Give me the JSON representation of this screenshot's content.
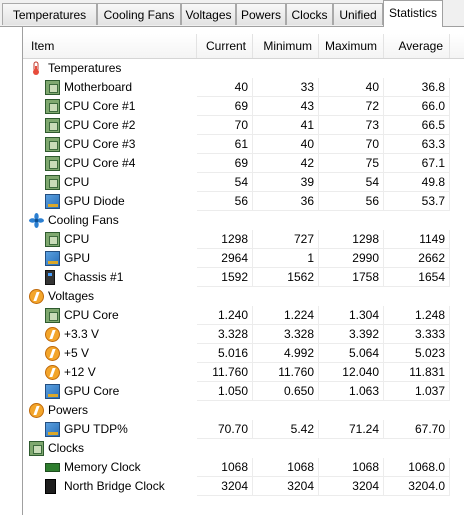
{
  "tabs": [
    {
      "label": "Temperatures",
      "active": false
    },
    {
      "label": "Cooling Fans",
      "active": false
    },
    {
      "label": "Voltages",
      "active": false
    },
    {
      "label": "Powers",
      "active": false
    },
    {
      "label": "Clocks",
      "active": false
    },
    {
      "label": "Unified",
      "active": false
    },
    {
      "label": "Statistics",
      "active": true
    }
  ],
  "columns": {
    "item": "Item",
    "current": "Current",
    "minimum": "Minimum",
    "maximum": "Maximum",
    "average": "Average"
  },
  "rows": [
    {
      "type": "group",
      "icon": "thermometer-icon",
      "label": "Temperatures"
    },
    {
      "type": "item",
      "icon": "motherboard-icon",
      "label": "Motherboard",
      "current": "40",
      "minimum": "33",
      "maximum": "40",
      "average": "36.8"
    },
    {
      "type": "item",
      "icon": "cpu-chip-icon",
      "label": "CPU Core #1",
      "current": "69",
      "minimum": "43",
      "maximum": "72",
      "average": "66.0"
    },
    {
      "type": "item",
      "icon": "cpu-chip-icon",
      "label": "CPU Core #2",
      "current": "70",
      "minimum": "41",
      "maximum": "73",
      "average": "66.5"
    },
    {
      "type": "item",
      "icon": "cpu-chip-icon",
      "label": "CPU Core #3",
      "current": "61",
      "minimum": "40",
      "maximum": "70",
      "average": "63.3"
    },
    {
      "type": "item",
      "icon": "cpu-chip-icon",
      "label": "CPU Core #4",
      "current": "69",
      "minimum": "42",
      "maximum": "75",
      "average": "67.1"
    },
    {
      "type": "item",
      "icon": "cpu-chip-icon",
      "label": "CPU",
      "current": "54",
      "minimum": "39",
      "maximum": "54",
      "average": "49.8"
    },
    {
      "type": "item",
      "icon": "gpu-card-icon",
      "label": "GPU Diode",
      "current": "56",
      "minimum": "36",
      "maximum": "56",
      "average": "53.7"
    },
    {
      "type": "group",
      "icon": "fan-icon",
      "label": "Cooling Fans"
    },
    {
      "type": "item",
      "icon": "cpu-chip-icon",
      "label": "CPU",
      "current": "1298",
      "minimum": "727",
      "maximum": "1298",
      "average": "1149"
    },
    {
      "type": "item",
      "icon": "gpu-card-icon",
      "label": "GPU",
      "current": "2964",
      "minimum": "1",
      "maximum": "2990",
      "average": "2662"
    },
    {
      "type": "item",
      "icon": "chassis-icon",
      "label": "Chassis #1",
      "current": "1592",
      "minimum": "1562",
      "maximum": "1758",
      "average": "1654"
    },
    {
      "type": "group",
      "icon": "voltage-bolt-icon",
      "label": "Voltages"
    },
    {
      "type": "item",
      "icon": "cpu-chip-icon",
      "label": "CPU Core",
      "current": "1.240",
      "minimum": "1.224",
      "maximum": "1.304",
      "average": "1.248"
    },
    {
      "type": "item",
      "icon": "voltage-bolt-icon",
      "label": "+3.3 V",
      "current": "3.328",
      "minimum": "3.328",
      "maximum": "3.392",
      "average": "3.333"
    },
    {
      "type": "item",
      "icon": "voltage-bolt-icon",
      "label": "+5 V",
      "current": "5.016",
      "minimum": "4.992",
      "maximum": "5.064",
      "average": "5.023"
    },
    {
      "type": "item",
      "icon": "voltage-bolt-icon",
      "label": "+12 V",
      "current": "11.760",
      "minimum": "11.760",
      "maximum": "12.040",
      "average": "11.831"
    },
    {
      "type": "item",
      "icon": "gpu-card-icon",
      "label": "GPU Core",
      "current": "1.050",
      "minimum": "0.650",
      "maximum": "1.063",
      "average": "1.037"
    },
    {
      "type": "group",
      "icon": "voltage-bolt-icon",
      "label": "Powers"
    },
    {
      "type": "item",
      "icon": "gpu-card-icon",
      "label": "GPU TDP%",
      "current": "70.70",
      "minimum": "5.42",
      "maximum": "71.24",
      "average": "67.70"
    },
    {
      "type": "group",
      "icon": "clock-chip-icon",
      "label": "Clocks"
    },
    {
      "type": "item",
      "icon": "memory-stick-icon",
      "label": "Memory Clock",
      "current": "1068",
      "minimum": "1068",
      "maximum": "1068",
      "average": "1068.0"
    },
    {
      "type": "item",
      "icon": "northbridge-icon",
      "label": "North Bridge Clock",
      "current": "3204",
      "minimum": "3204",
      "maximum": "3204",
      "average": "3204.0"
    }
  ]
}
